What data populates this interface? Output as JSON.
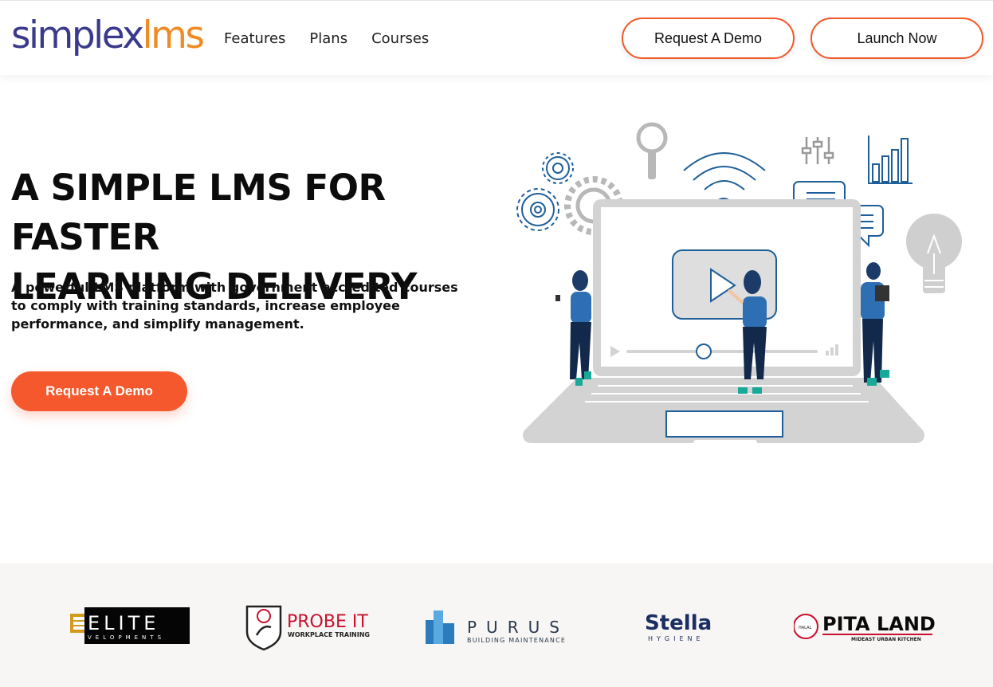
{
  "header": {
    "logo": {
      "part1": "simplex",
      "part2": "lms"
    },
    "nav": [
      "Features",
      "Plans",
      "Courses"
    ],
    "request_demo_label": "Request A Demo",
    "launch_label": "Launch Now"
  },
  "hero": {
    "title_line1": "A SIMPLE LMS FOR FASTER",
    "title_line2": "LEARNING DELIVERY",
    "subtitle": "A powerful LMS platform with government accredited courses to comply with training standards, increase employee performance, and simplify management.",
    "cta_label": "Request A Demo"
  },
  "clients": {
    "elite": {
      "name": "ELITE",
      "tag": "VELOPMENTS"
    },
    "probe": {
      "name": "PROBE IT",
      "tag": "WORKPLACE TRAINING"
    },
    "purus": {
      "name": "PURUS",
      "tag": "BUILDING MAINTENANCE"
    },
    "stella": {
      "name": "Stella",
      "tag": "HYGIENE"
    },
    "pita": {
      "name": "PITA LAND",
      "tag": "MIDEAST URBAN KITCHEN",
      "badge": "HALAL"
    }
  },
  "colors": {
    "accent": "#f4582c",
    "logo_blue": "#3a3a8c",
    "logo_orange": "#f08a24",
    "illustration_blue": "#1f5f99"
  }
}
